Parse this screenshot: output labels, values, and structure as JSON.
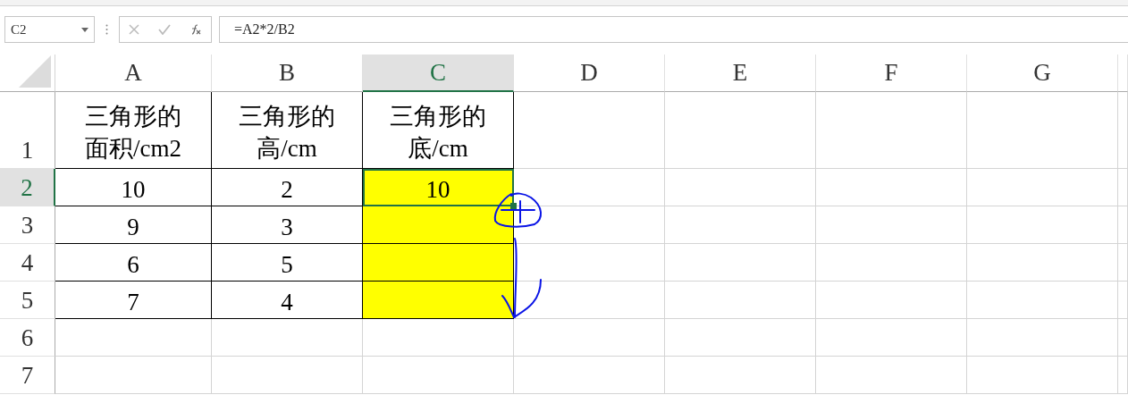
{
  "formula_bar": {
    "name_box": "C2",
    "formula": "=A2*2/B2"
  },
  "columns": [
    {
      "label": "A",
      "selected": false
    },
    {
      "label": "B",
      "selected": false
    },
    {
      "label": "C",
      "selected": true
    },
    {
      "label": "D",
      "selected": false
    },
    {
      "label": "E",
      "selected": false
    },
    {
      "label": "F",
      "selected": false
    },
    {
      "label": "G",
      "selected": false
    }
  ],
  "rows": [
    {
      "label": "1",
      "selected": false,
      "cells": [
        {
          "text": "三角形的面积/cm2",
          "bordered": true,
          "highlighted": false,
          "selected": false
        },
        {
          "text": "三角形的高/cm",
          "bordered": true,
          "highlighted": false,
          "selected": false
        },
        {
          "text": "三角形的底/cm",
          "bordered": true,
          "highlighted": false,
          "selected": false
        }
      ]
    },
    {
      "label": "2",
      "selected": true,
      "cells": [
        {
          "text": "10",
          "bordered": true,
          "highlighted": false,
          "selected": false
        },
        {
          "text": "2",
          "bordered": true,
          "highlighted": false,
          "selected": false
        },
        {
          "text": "10",
          "bordered": true,
          "highlighted": true,
          "selected": true
        }
      ]
    },
    {
      "label": "3",
      "selected": false,
      "cells": [
        {
          "text": "9",
          "bordered": true,
          "highlighted": false,
          "selected": false
        },
        {
          "text": "3",
          "bordered": true,
          "highlighted": false,
          "selected": false
        },
        {
          "bordered": true,
          "highlighted": true,
          "selected": false
        }
      ]
    },
    {
      "label": "4",
      "selected": false,
      "cells": [
        {
          "text": "6",
          "bordered": true,
          "highlighted": false,
          "selected": false
        },
        {
          "text": "5",
          "bordered": true,
          "highlighted": false,
          "selected": false
        },
        {
          "bordered": true,
          "highlighted": true,
          "selected": false
        }
      ]
    },
    {
      "label": "5",
      "selected": false,
      "cells": [
        {
          "text": "7",
          "bordered": true,
          "highlighted": false,
          "selected": false
        },
        {
          "text": "4",
          "bordered": true,
          "highlighted": false,
          "selected": false
        },
        {
          "bordered": true,
          "highlighted": true,
          "selected": false
        }
      ]
    },
    {
      "label": "6",
      "selected": false
    },
    {
      "label": "7",
      "selected": false
    }
  ]
}
